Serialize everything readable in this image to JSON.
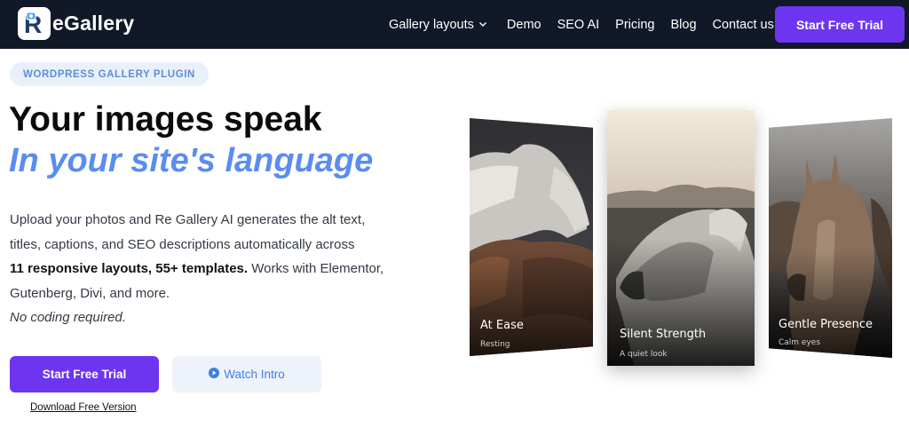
{
  "nav": {
    "logo_letter": "R",
    "logo_text": "eGallery",
    "links": [
      {
        "label": "Gallery layouts",
        "has_dropdown": true
      },
      {
        "label": "Demo"
      },
      {
        "label": "SEO AI"
      },
      {
        "label": "Pricing"
      },
      {
        "label": "Blog"
      },
      {
        "label": "Contact us"
      }
    ],
    "cta": "Start Free Trial"
  },
  "hero": {
    "badge": "WORDPRESS GALLERY PLUGIN",
    "headline": "Your images speak",
    "headline_accent": "In your site's language",
    "description": {
      "line1": "Upload your photos and Re Gallery AI generates the alt text,",
      "line2": "titles, captions, and SEO descriptions automatically across",
      "line3_bold": "11 responsive layouts, 55+ templates.",
      "line3_rest": " Works with Elementor,",
      "line4": "Gutenberg, Divi, and more.",
      "line5_italic": "No coding required."
    },
    "primary_button": "Start Free Trial",
    "secondary_button": "Watch Intro",
    "download_link": "Download Free Version"
  },
  "gallery": [
    {
      "title": "At Ease",
      "caption": "Resting"
    },
    {
      "title": "Silent Strength",
      "caption": "A quiet look"
    },
    {
      "title": "Gentle Presence",
      "caption": "Calm eyes"
    }
  ],
  "colors": {
    "nav_bg": "#111827",
    "accent_purple": "#6d35f0",
    "accent_blue": "#5b8def",
    "badge_bg": "#eaf0fb",
    "secondary_button_bg": "#eef2fb"
  },
  "icons": {
    "dropdown": "chevron-down-icon",
    "play": "play-circle-icon",
    "logo": "regallery-logo-icon"
  }
}
